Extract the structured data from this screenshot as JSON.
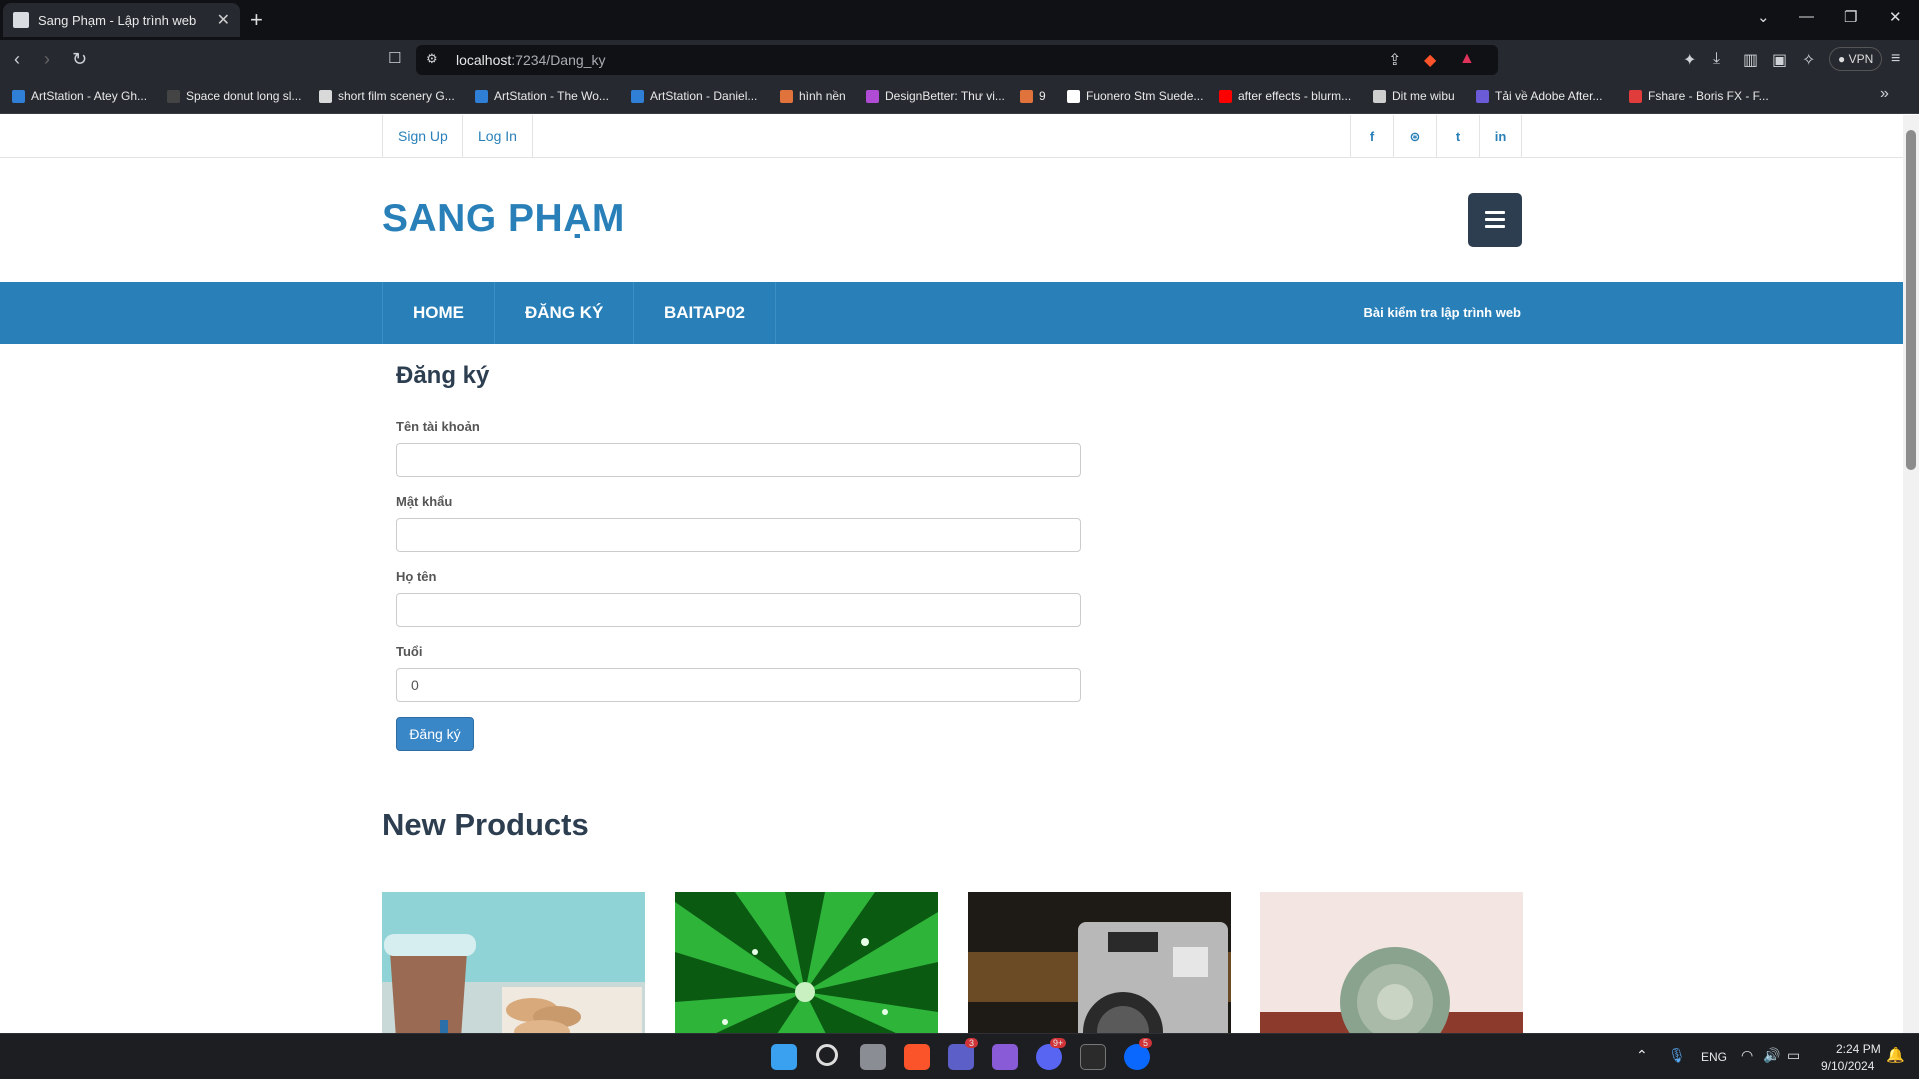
{
  "browser": {
    "tab_title": "Sang Phạm - Lập trình web",
    "url_host": "localhost",
    "url_rest": ":7234/Dang_ky",
    "vpn_label": "VPN",
    "bookmarks": [
      {
        "label": "ArtStation - Atey Gh...",
        "color": "#2f7fd6"
      },
      {
        "label": "Space donut long sl...",
        "color": "#444"
      },
      {
        "label": "short film scenery G...",
        "color": "#d9d9d9"
      },
      {
        "label": "ArtStation - The Wo...",
        "color": "#2f7fd6"
      },
      {
        "label": "ArtStation - Daniel...",
        "color": "#2f7fd6"
      },
      {
        "label": "hình nền",
        "color": "#e0733c"
      },
      {
        "label": "DesignBetter: Thư vi...",
        "color": "#b04bd6"
      },
      {
        "label": "9",
        "color": "#e0733c"
      },
      {
        "label": "Fuonero Stm Suede...",
        "color": "#ffffff"
      },
      {
        "label": "after effects - blurm...",
        "color": "#ff0000"
      },
      {
        "label": "Dit me wibu",
        "color": "#cfcfcf"
      },
      {
        "label": "Tải về Adobe After...",
        "color": "#6b5bd6"
      },
      {
        "label": "Fshare - Boris FX - F...",
        "color": "#e03c3c"
      }
    ]
  },
  "topbar": {
    "signup": "Sign Up",
    "login": "Log In",
    "social": [
      "f",
      "⊛",
      "t",
      "in"
    ]
  },
  "brand": "SANG PHẠM",
  "nav": {
    "items": [
      "HOME",
      "ĐĂNG KÝ",
      "BAITAP02"
    ],
    "note": "Bài kiểm tra lập trình web"
  },
  "form": {
    "title": "Đăng ký",
    "username_label": "Tên tài khoản",
    "username_value": "",
    "password_label": "Mật khẩu",
    "password_value": "",
    "fullname_label": "Họ tên",
    "fullname_value": "",
    "age_label": "Tuổi",
    "age_value": "0",
    "submit_label": "Đăng ký"
  },
  "products": {
    "title": "New Products"
  },
  "taskbar": {
    "badges": {
      "teams": "3",
      "discord": "9+",
      "zalo": "5"
    },
    "lang": "ENG",
    "time": "2:24 PM",
    "date": "9/10/2024"
  },
  "colors": {
    "primary": "#2980b9",
    "dark": "#2c3e50"
  }
}
